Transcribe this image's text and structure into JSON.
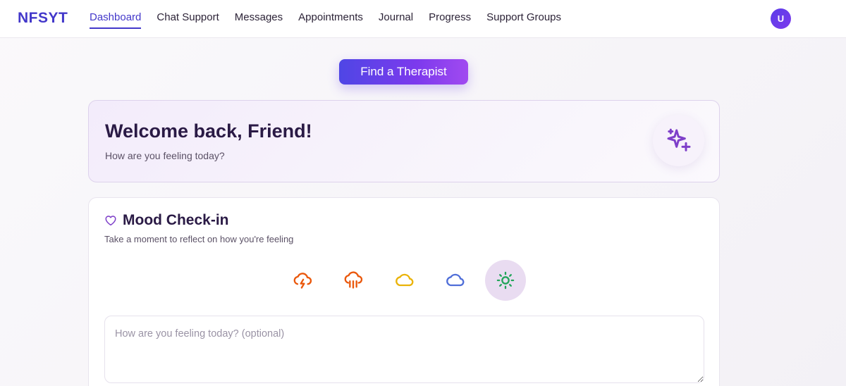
{
  "nav": {
    "brand": "NFSYT",
    "links": [
      {
        "label": "Dashboard",
        "active": true
      },
      {
        "label": "Chat Support",
        "active": false
      },
      {
        "label": "Messages",
        "active": false
      },
      {
        "label": "Appointments",
        "active": false
      },
      {
        "label": "Journal",
        "active": false
      },
      {
        "label": "Progress",
        "active": false
      },
      {
        "label": "Support Groups",
        "active": false
      }
    ],
    "avatar_initial": "U"
  },
  "cta": {
    "label": "Find a Therapist"
  },
  "welcome": {
    "title": "Welcome back, Friend!",
    "subtitle": "How are you feeling today?",
    "icon": "sparkles-icon"
  },
  "mood": {
    "icon": "heart-icon",
    "title": "Mood Check-in",
    "subtitle": "Take a moment to reflect on how you're feeling",
    "options": [
      {
        "icon": "cloud-lightning-icon",
        "color": "#ea580c"
      },
      {
        "icon": "cloud-rain-icon",
        "color": "#ea580c"
      },
      {
        "icon": "cloud-icon",
        "color": "#eab308"
      },
      {
        "icon": "cloud-icon",
        "color": "#4f6ed8"
      },
      {
        "icon": "sun-icon",
        "color": "#22a55a",
        "selected": true
      }
    ],
    "note_placeholder": "How are you feeling today? (optional)"
  },
  "colors": {
    "brand": "#4338ca",
    "accent": "#7c3aed",
    "title": "#2a1a45"
  }
}
